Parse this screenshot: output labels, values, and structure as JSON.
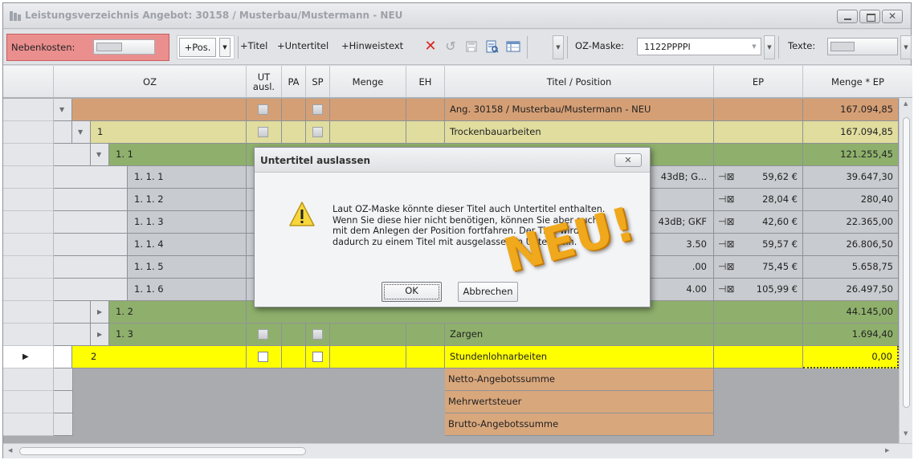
{
  "window": {
    "title": "Leistungsverzeichnis Angebot: 30158 / Musterbau/Mustermann - NEU"
  },
  "toolbar": {
    "nebenkosten_label": "Nebenkosten:",
    "add_pos": "+Pos.",
    "add_titel": "+Titel",
    "add_untertitel": "+Untertitel",
    "add_hinweistext": "+Hinweistext",
    "oz_maske_label": "OZ-Maske:",
    "oz_maske_value": "1122PPPPI",
    "texte_label": "Texte:"
  },
  "columns": {
    "oz": "OZ",
    "ut_ausl": "UT\nausl.",
    "pa": "PA",
    "sp": "SP",
    "menge": "Menge",
    "eh": "EH",
    "titel_position": "Titel / Position",
    "ep": "EP",
    "menge_ep": "Menge * EP"
  },
  "rows": [
    {
      "oz": "",
      "titel": "Ang. 30158 / Musterbau/Mustermann - NEU",
      "ep": "",
      "total": "167.094,85"
    },
    {
      "oz": "1",
      "titel": "Trockenbauarbeiten",
      "ep": "",
      "total": "167.094,85"
    },
    {
      "oz": "1. 1",
      "titel": "",
      "ep": "",
      "total": "121.255,45"
    },
    {
      "oz": "1. 1.  1",
      "titel": "43dB; G...",
      "ep": "59,62 €",
      "total": "39.647,30"
    },
    {
      "oz": "1. 1.  2",
      "titel": "",
      "ep": "28,04 €",
      "total": "280,40"
    },
    {
      "oz": "1. 1.  3",
      "titel": "43dB; GKF",
      "ep": "42,60 €",
      "total": "22.365,00"
    },
    {
      "oz": "1. 1.  4",
      "titel": "3.50",
      "ep": "59,57 €",
      "total": "26.806,50"
    },
    {
      "oz": "1. 1.  5",
      "titel": ".00",
      "ep": "75,45 €",
      "total": "5.658,75"
    },
    {
      "oz": "1. 1.  6",
      "titel": "4.00",
      "ep": "105,99 €",
      "total": "26.497,50"
    },
    {
      "oz": "1. 2",
      "titel": "",
      "ep": "",
      "total": "44.145,00"
    },
    {
      "oz": "1. 3",
      "titel": "Zargen",
      "ep": "",
      "total": "1.694,40"
    },
    {
      "oz": "2",
      "titel": "Stundenlohnarbeiten",
      "ep": "",
      "total": "0,00"
    }
  ],
  "summary": [
    "Netto-Angebotssumme",
    "Mehrwertsteuer",
    "Brutto-Angebotssumme"
  ],
  "dialog": {
    "title": "Untertitel auslassen",
    "message": "Laut OZ-Maske könnte dieser Titel auch Untertitel enthalten.\nWenn Sie diese hier nicht benötigen, können Sie aber auch\nmit dem Anlegen der Position fortfahren. Der Titel wird\ndadurch zu einem Titel mit ausgelassenen Untertiteln.",
    "ok": "OK",
    "cancel": "Abbrechen"
  },
  "stamp": "NEU!",
  "colors": {
    "root_row": "#d59f75",
    "title_row": "#e0dd9e",
    "subtitle_row": "#8fb06c",
    "position_row": "#c8cbcf",
    "selected_row": "#ffff00",
    "summary_cell": "#d9a77c",
    "stamp": "#f0a81c"
  }
}
